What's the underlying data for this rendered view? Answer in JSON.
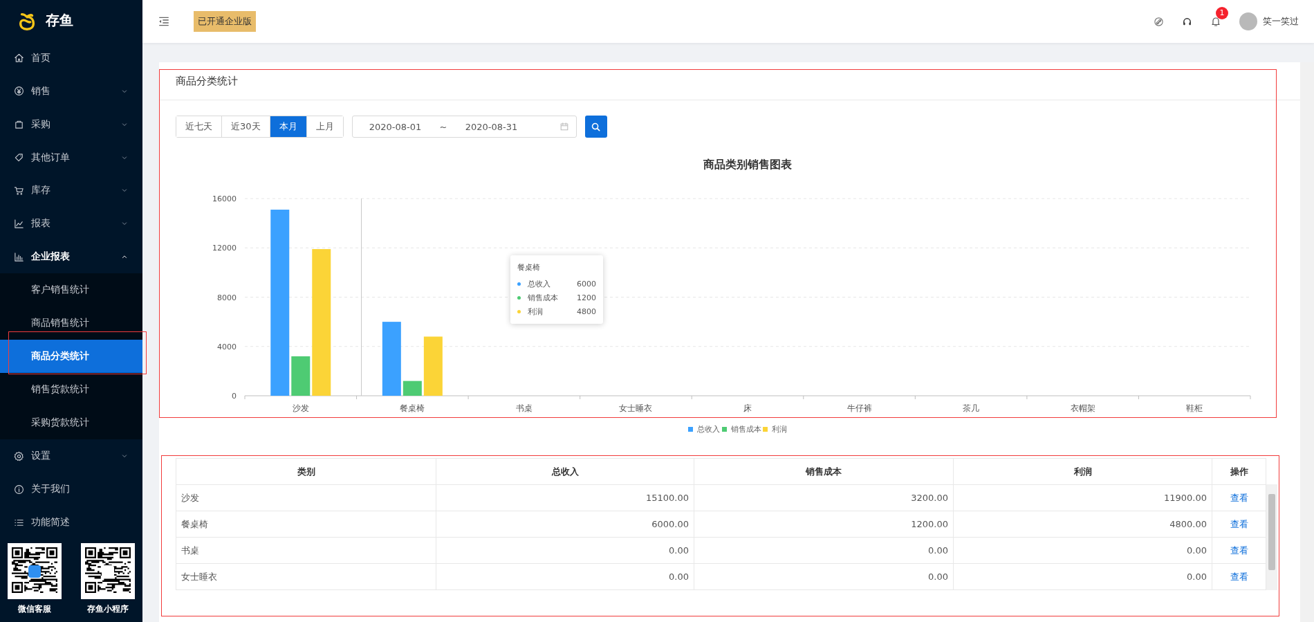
{
  "sidebar": {
    "logo": "存鱼",
    "items": [
      {
        "kind": "link",
        "label": "首页"
      },
      {
        "kind": "group",
        "label": "销售",
        "expanded": false
      },
      {
        "kind": "group",
        "label": "采购",
        "expanded": false
      },
      {
        "kind": "group",
        "label": "其他订单",
        "expanded": false
      },
      {
        "kind": "group",
        "label": "库存",
        "expanded": false
      },
      {
        "kind": "group",
        "label": "报表",
        "expanded": false
      },
      {
        "kind": "group",
        "label": "企业报表",
        "expanded": true,
        "children": [
          {
            "label": "客户销售统计",
            "selected": false
          },
          {
            "label": "商品销售统计",
            "selected": false
          },
          {
            "label": "商品分类统计",
            "selected": true
          },
          {
            "label": "销售货款统计",
            "selected": false
          },
          {
            "label": "采购货款统计",
            "selected": false
          }
        ]
      },
      {
        "kind": "group",
        "label": "设置",
        "expanded": false
      },
      {
        "kind": "link",
        "label": "关于我们"
      },
      {
        "kind": "link",
        "label": "功能简述"
      }
    ],
    "qr_codes": [
      {
        "caption": "微信客服"
      },
      {
        "caption": "存鱼小程序"
      }
    ]
  },
  "header": {
    "edition_badge": "已开通企业版",
    "notification_count": "1",
    "user_name": "笑一笑过"
  },
  "card": {
    "title": "商品分类统计",
    "ranges": [
      {
        "label": "近七天",
        "selected": false
      },
      {
        "label": "近30天",
        "selected": false
      },
      {
        "label": "本月",
        "selected": true
      },
      {
        "label": "上月",
        "selected": false
      }
    ],
    "date_range": {
      "start": "2020-08-01",
      "separator": "~",
      "end": "2020-08-31"
    },
    "chart_data": {
      "type": "bar",
      "title": "商品类别销售图表",
      "categories": [
        "沙发",
        "餐桌椅",
        "书桌",
        "女士睡衣",
        "床",
        "牛仔裤",
        "茶几",
        "衣帽架",
        "鞋柜"
      ],
      "ylim": [
        0,
        16000
      ],
      "grid": true,
      "legend": true,
      "yticks": [
        0,
        4000,
        8000,
        12000,
        16000
      ],
      "series": [
        {
          "name": "总收入",
          "color": "#3ba1ff",
          "values": [
            15100,
            6000,
            0,
            0,
            0,
            0,
            0,
            0,
            0
          ]
        },
        {
          "name": "销售成本",
          "color": "#4ecb73",
          "values": [
            3200,
            1200,
            0,
            0,
            0,
            0,
            0,
            0,
            0
          ]
        },
        {
          "name": "利润",
          "color": "#fbd437",
          "values": [
            11900,
            4800,
            0,
            0,
            0,
            0,
            0,
            0,
            0
          ]
        }
      ]
    },
    "tooltip": {
      "title": "餐桌椅",
      "rows": [
        {
          "label": "总收入",
          "value": "6000",
          "color": "#3ba1ff"
        },
        {
          "label": "销售成本",
          "value": "1200",
          "color": "#4ecb73"
        },
        {
          "label": "利润",
          "value": "4800",
          "color": "#fbd437"
        }
      ]
    }
  },
  "table": {
    "columns": [
      "类别",
      "总收入",
      "销售成本",
      "利润",
      "操作"
    ],
    "rows": [
      {
        "cells": [
          "沙发",
          "15100.00",
          "3200.00",
          "11900.00"
        ],
        "action": "查看"
      },
      {
        "cells": [
          "餐桌椅",
          "6000.00",
          "1200.00",
          "4800.00"
        ],
        "action": "查看"
      },
      {
        "cells": [
          "书桌",
          "0.00",
          "0.00",
          "0.00"
        ],
        "action": "查看"
      },
      {
        "cells": [
          "女士睡衣",
          "0.00",
          "0.00",
          "0.00"
        ],
        "action": "查看"
      }
    ]
  }
}
